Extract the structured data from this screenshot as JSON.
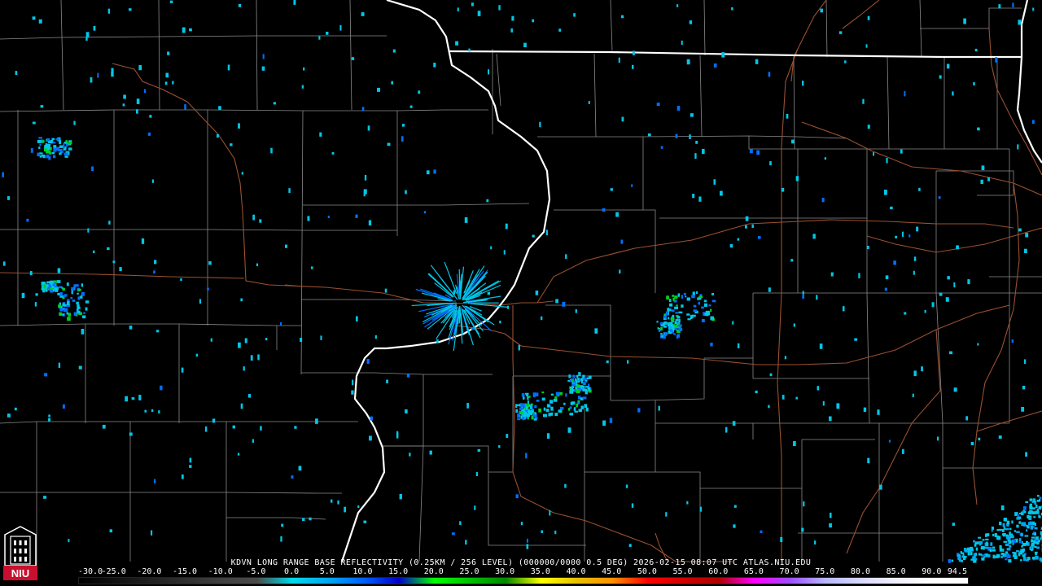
{
  "caption": "KDVN LONG RANGE BASE REFLECTIVITY (0.25KM / 256 LEVEL) (000000/0000 0.5 DEG) 2026-02-15 08:07 UTC  ATLAS.NIU.EDU",
  "logo": {
    "text": "NIU",
    "icon": "niu-logo-icon"
  },
  "scale": {
    "labels": [
      "-30.0",
      "-25.0",
      "-20.0",
      "-15.0",
      "-10.0",
      "-5.0",
      "0.0",
      "5.0",
      "10.0",
      "15.0",
      "20.0",
      "25.0",
      "30.0",
      "35.0",
      "40.0",
      "45.0",
      "50.0",
      "55.0",
      "60.0",
      "65.0",
      "70.0",
      "75.0",
      "80.0",
      "85.0",
      "90.0",
      "94.5"
    ],
    "colors": [
      "#000000",
      "#101010",
      "#202020",
      "#303030",
      "#404040",
      "#4a4a4a",
      "#00d8e8",
      "#00a8f0",
      "#0060ff",
      "#0000c8",
      "#00ff00",
      "#00c000",
      "#008800",
      "#ffff00",
      "#e8c000",
      "#ff9000",
      "#ff0000",
      "#d00000",
      "#b00000",
      "#ff00ff",
      "#9a50ff",
      "#b8b8ff",
      "#d8d8ff",
      "#f0f0ff",
      "#ffffff",
      "#ffffff"
    ]
  },
  "colors": {
    "background": "#000000",
    "state_border": "#ffffff",
    "county_border": "#8a8a8a",
    "highway": "#9a5030",
    "echo_light": "#00c8e8",
    "echo_mid": "#0070ff",
    "echo_strong": "#00d020"
  }
}
